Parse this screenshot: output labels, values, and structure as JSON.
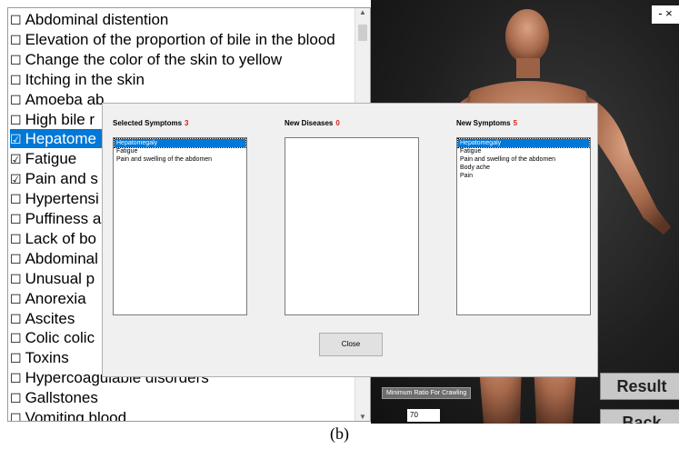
{
  "symptoms": [
    {
      "label": "Abdominal distention",
      "checked": false
    },
    {
      "label": "Elevation of the proportion of bile in the blood",
      "checked": false
    },
    {
      "label": "Change the color of the skin to yellow",
      "checked": false
    },
    {
      "label": "Itching in the skin",
      "checked": false
    },
    {
      "label": "Amoeba ab",
      "checked": false
    },
    {
      "label": "High bile r",
      "checked": false
    },
    {
      "label": "Hepatome",
      "checked": true
    },
    {
      "label": "Fatigue",
      "checked": true
    },
    {
      "label": "Pain and s",
      "checked": true
    },
    {
      "label": "Hypertensi",
      "checked": false
    },
    {
      "label": "Puffiness a",
      "checked": false
    },
    {
      "label": "Lack of bo",
      "checked": false
    },
    {
      "label": "Abdominal",
      "checked": false
    },
    {
      "label": "Unusual p",
      "checked": false
    },
    {
      "label": "Anorexia",
      "checked": false
    },
    {
      "label": "Ascites",
      "checked": false
    },
    {
      "label": "Colic colic",
      "checked": false
    },
    {
      "label": "Toxins",
      "checked": false
    },
    {
      "label": "Hypercoagulable disorders",
      "checked": false
    },
    {
      "label": "Gallstones",
      "checked": false
    },
    {
      "label": "Vomiting blood",
      "checked": false
    }
  ],
  "checkbox_unchecked": "☐",
  "checkbox_checked": "☑",
  "window_controls": "-  ×",
  "dialog": {
    "selected_symptoms": {
      "title": "Selected Symptoms",
      "count": "3",
      "items": [
        "Hepatomegaly",
        "Fatigue",
        "Pain and swelling of the abdomen"
      ]
    },
    "new_diseases": {
      "title": "New Diseases",
      "count": "0",
      "items": []
    },
    "new_symptoms": {
      "title": "New Symptoms",
      "count": "5",
      "items": [
        "Hepatomegaly",
        "Fatigue",
        "Pain and swelling of the abdomen",
        "Body ache",
        "Pain"
      ]
    },
    "close_label": "Close"
  },
  "viewer": {
    "min_ratio_label": "Minimum Ratio For Crawling",
    "min_ratio_value": "70",
    "result_label": "Result",
    "back_label": "Back"
  },
  "caption": "(b)",
  "colors": {
    "selection": "#0078d7",
    "count_red": "#e02020",
    "viewer_bg": "#1f1f1f"
  }
}
